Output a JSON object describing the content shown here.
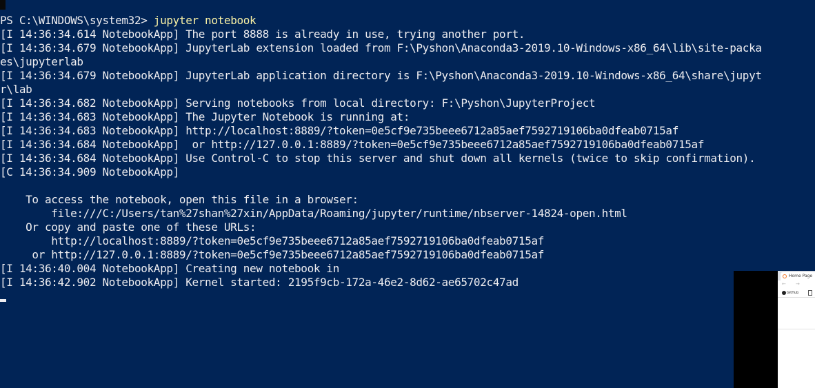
{
  "terminal": {
    "prompt": "PS C:\\WINDOWS\\system32> ",
    "command": "jupyter notebook",
    "lines": [
      "[I 14:36:34.614 NotebookApp] The port 8888 is already in use, trying another port.",
      "[I 14:36:34.679 NotebookApp] JupyterLab extension loaded from F:\\Pyshon\\Anaconda3-2019.10-Windows-x86_64\\lib\\site-packa",
      "es\\jupyterlab",
      "[I 14:36:34.679 NotebookApp] JupyterLab application directory is F:\\Pyshon\\Anaconda3-2019.10-Windows-x86_64\\share\\jupyt",
      "r\\lab",
      "[I 14:36:34.682 NotebookApp] Serving notebooks from local directory: F:\\Pyshon\\JupyterProject",
      "[I 14:36:34.683 NotebookApp] The Jupyter Notebook is running at:",
      "[I 14:36:34.683 NotebookApp] http://localhost:8889/?token=0e5cf9e735beee6712a85aef7592719106ba0dfeab0715af",
      "[I 14:36:34.684 NotebookApp]  or http://127.0.0.1:8889/?token=0e5cf9e735beee6712a85aef7592719106ba0dfeab0715af",
      "[I 14:36:34.684 NotebookApp] Use Control-C to stop this server and shut down all kernels (twice to skip confirmation).",
      "[C 14:36:34.909 NotebookApp]",
      "",
      "    To access the notebook, open this file in a browser:",
      "        file:///C:/Users/tan%27shan%27xin/AppData/Roaming/jupyter/runtime/nbserver-14824-open.html",
      "    Or copy and paste one of these URLs:",
      "        http://localhost:8889/?token=0e5cf9e735beee6712a85aef7592719106ba0dfeab0715af",
      "     or http://127.0.0.1:8889/?token=0e5cf9e735beee6712a85aef7592719106ba0dfeab0715af",
      "[I 14:36:40.004 NotebookApp] Creating new notebook in",
      "[I 14:36:42.902 NotebookApp] Kernel started: 2195f9cb-172a-46e2-8d62-ae65702c47ad"
    ]
  },
  "colors": {
    "background": "#012456",
    "text": "#eeedf0",
    "command": "#f9f1a5"
  },
  "thumbnail": {
    "tab_title": "Home Page",
    "tab_icon": "jupyter-logo-icon",
    "nav_back": "←",
    "nav_forward": "→",
    "bookmark_icon": "github-icon",
    "bookmark_label": "GitHub",
    "bookmark2_icon": "document-icon"
  }
}
